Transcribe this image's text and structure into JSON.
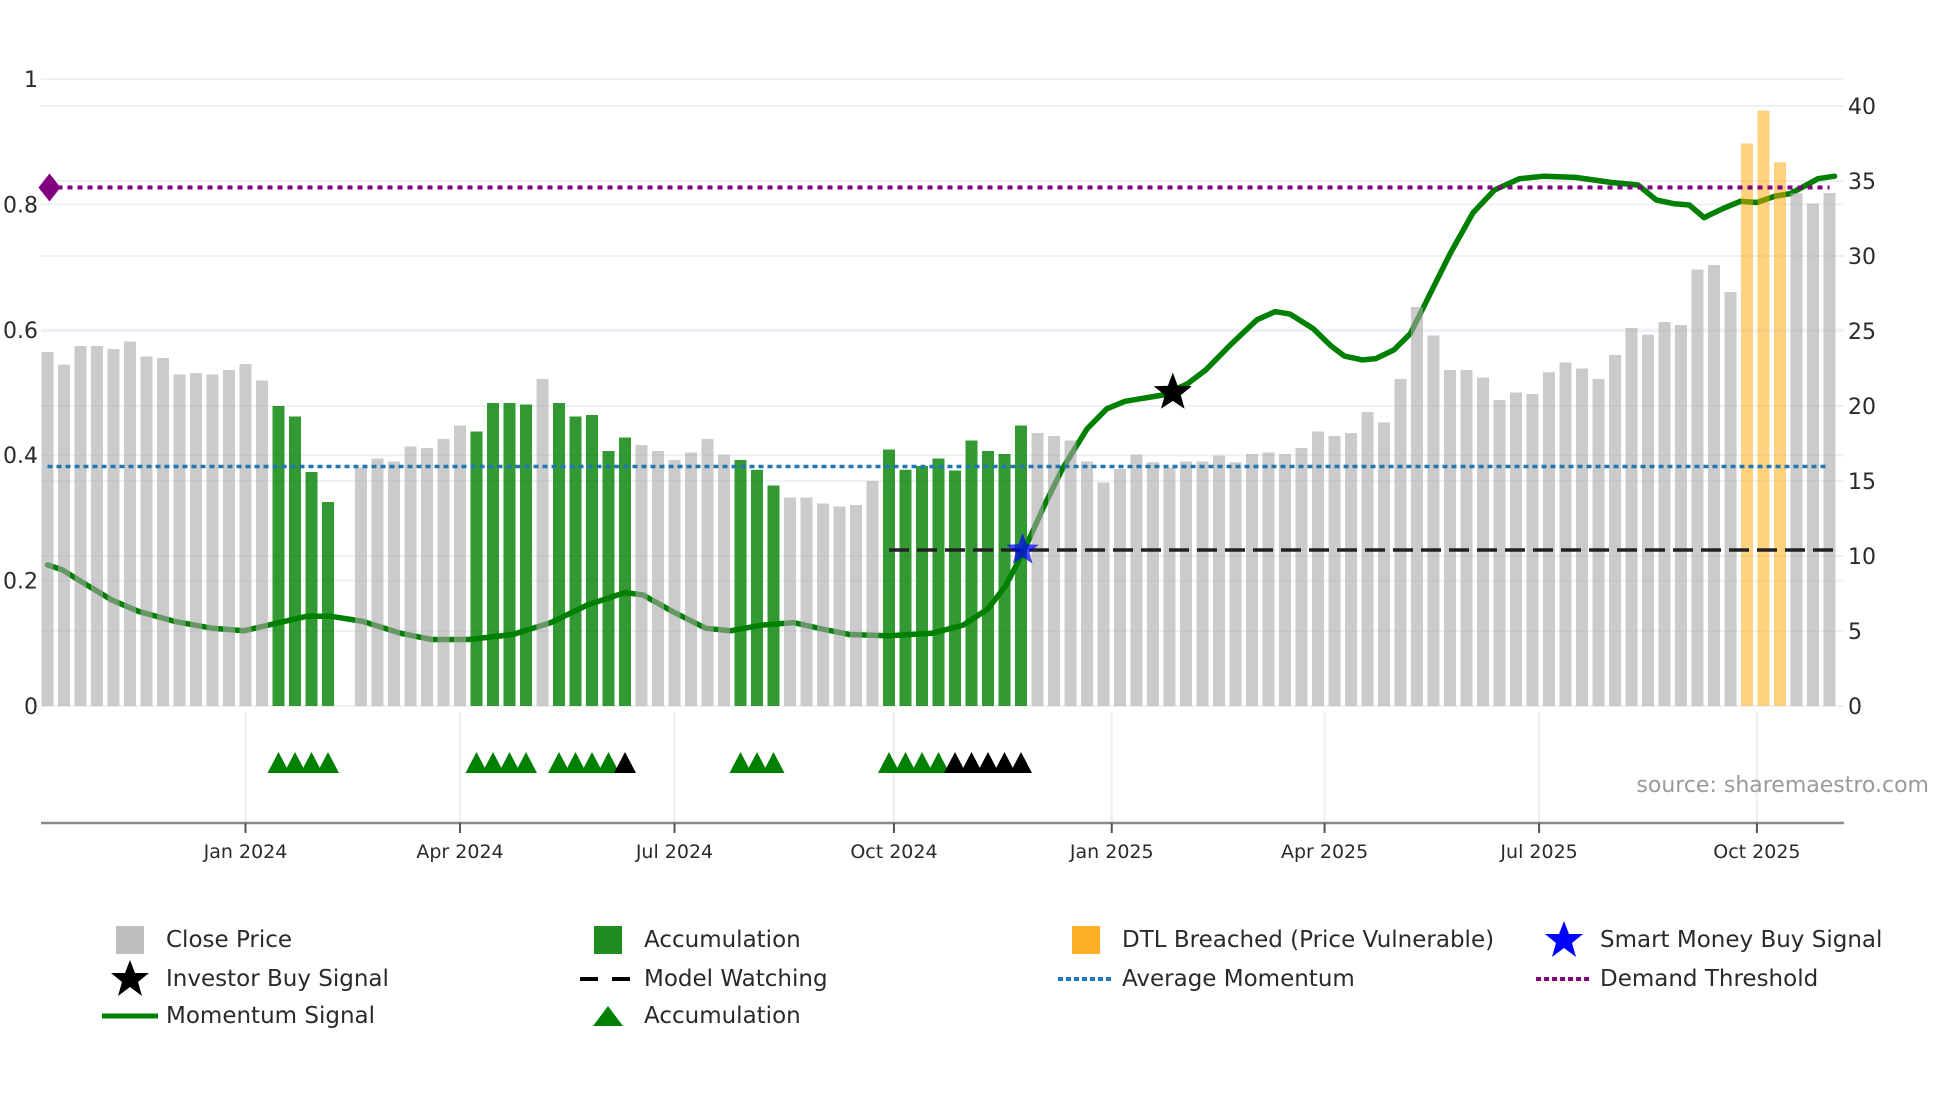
{
  "chart_data": {
    "type": "bar",
    "x_unit": "week index (weekly bars, first bar = week 0)",
    "x_ticks": [
      {
        "label": "Jan 2024",
        "x": 12.0
      },
      {
        "label": "Apr 2024",
        "x": 25.0
      },
      {
        "label": "Jul 2024",
        "x": 38.0
      },
      {
        "label": "Oct 2024",
        "x": 51.3
      },
      {
        "label": "Jan 2025",
        "x": 64.5
      },
      {
        "label": "Apr 2025",
        "x": 77.4
      },
      {
        "label": "Jul 2025",
        "x": 90.4
      },
      {
        "label": "Oct 2025",
        "x": 103.6
      }
    ],
    "y_left": {
      "range": [
        0,
        1
      ],
      "ticks": [
        "0",
        "0.2",
        "0.4",
        "0.6",
        "0.8",
        "1"
      ],
      "tick_values": [
        0,
        0.2,
        0.4,
        0.6,
        0.8,
        1
      ]
    },
    "y_right": {
      "range": [
        0,
        40
      ],
      "ticks": [
        "0",
        "5",
        "10",
        "15",
        "20",
        "25",
        "30",
        "35",
        "40"
      ],
      "tick_values": [
        0,
        5,
        10,
        15,
        20,
        25,
        30,
        35,
        40
      ]
    },
    "colors": {
      "close": "#a9a9a9",
      "accumulation": "#008000",
      "dtl": "#ffa500",
      "momentum": "#008000",
      "average": "#1f77b4",
      "demand": "#800080",
      "watching": "#000000",
      "smart_money": "#0000ff",
      "investor": "#000000"
    },
    "close_price": [
      23.6,
      22.75,
      24,
      24,
      23.8,
      24.3,
      23.3,
      23.2,
      22.1,
      22.2,
      22.1,
      22.4,
      22.8,
      21.7,
      20,
      19.3,
      15.6,
      13.6,
      null,
      15.9,
      16.5,
      16.3,
      17.3,
      17.2,
      17.8,
      18.7,
      18.3,
      20.2,
      20.2,
      20.1,
      21.8,
      20.2,
      19.3,
      19.4,
      17,
      17.9,
      17.4,
      17,
      16.4,
      16.9,
      17.8,
      16.75,
      16.4,
      15.75,
      14.7,
      13.9,
      13.9,
      13.5,
      13.3,
      13.4,
      15,
      17.1,
      15.75,
      16,
      16.5,
      15.7,
      17.7,
      17,
      16.8,
      18.7,
      18.2,
      18,
      17.7,
      16.3,
      14.9,
      15.8,
      16.75,
      16.25,
      15.9,
      16.3,
      16.3,
      16.7,
      16.25,
      16.8,
      16.9,
      16.8,
      17.2,
      18.3,
      18,
      18.2,
      19.6,
      18.9,
      21.8,
      26.6,
      24.7,
      22.4,
      22.4,
      21.9,
      20.4,
      20.9,
      20.8,
      22.25,
      22.9,
      22.5,
      21.8,
      23.4,
      25.2,
      24.75,
      25.6,
      25.4,
      29.1,
      29.4,
      27.6,
      37.5,
      39.7,
      36.25,
      34.2,
      33.5,
      34.2
    ],
    "bar_state_ranges": [
      {
        "state": "accumulation",
        "from": 14,
        "to": 17
      },
      {
        "state": "accumulation",
        "from": 26,
        "to": 29
      },
      {
        "state": "accumulation",
        "from": 31,
        "to": 35
      },
      {
        "state": "accumulation",
        "from": 42,
        "to": 44
      },
      {
        "state": "accumulation",
        "from": 51,
        "to": 59
      },
      {
        "state": "dtl",
        "from": 103,
        "to": 105
      }
    ],
    "momentum_signal": [
      [
        0,
        0.225
      ],
      [
        0.9,
        0.217
      ],
      [
        2,
        0.199
      ],
      [
        3.9,
        0.169
      ],
      [
        5.5,
        0.151
      ],
      [
        7.7,
        0.135
      ],
      [
        10,
        0.124
      ],
      [
        11.9,
        0.12
      ],
      [
        13.4,
        0.129
      ],
      [
        15.7,
        0.143
      ],
      [
        17.2,
        0.143
      ],
      [
        19.1,
        0.135
      ],
      [
        21.4,
        0.116
      ],
      [
        23.3,
        0.106
      ],
      [
        25.5,
        0.106
      ],
      [
        28.2,
        0.114
      ],
      [
        30.5,
        0.133
      ],
      [
        32.7,
        0.161
      ],
      [
        35,
        0.181
      ],
      [
        36.1,
        0.177
      ],
      [
        38,
        0.149
      ],
      [
        39.9,
        0.124
      ],
      [
        41.4,
        0.12
      ],
      [
        43.3,
        0.129
      ],
      [
        45.2,
        0.133
      ],
      [
        47.1,
        0.122
      ],
      [
        48.6,
        0.114
      ],
      [
        50.9,
        0.112
      ],
      [
        53.6,
        0.116
      ],
      [
        55.5,
        0.129
      ],
      [
        57,
        0.155
      ],
      [
        58.1,
        0.193
      ],
      [
        59.2,
        0.249
      ],
      [
        60.4,
        0.319
      ],
      [
        61.5,
        0.378
      ],
      [
        63,
        0.442
      ],
      [
        64.2,
        0.474
      ],
      [
        65.3,
        0.486
      ],
      [
        67.6,
        0.496
      ],
      [
        69.1,
        0.514
      ],
      [
        70.2,
        0.536
      ],
      [
        71.7,
        0.576
      ],
      [
        73.3,
        0.616
      ],
      [
        74.4,
        0.629
      ],
      [
        75.3,
        0.625
      ],
      [
        76.7,
        0.602
      ],
      [
        77.8,
        0.574
      ],
      [
        78.6,
        0.558
      ],
      [
        79.7,
        0.552
      ],
      [
        80.5,
        0.554
      ],
      [
        81.6,
        0.568
      ],
      [
        82.6,
        0.594
      ],
      [
        83.6,
        0.647
      ],
      [
        85,
        0.721
      ],
      [
        86.4,
        0.787
      ],
      [
        87.7,
        0.823
      ],
      [
        89.2,
        0.841
      ],
      [
        90.7,
        0.845
      ],
      [
        92.6,
        0.843
      ],
      [
        94.8,
        0.835
      ],
      [
        96.4,
        0.831
      ],
      [
        97.5,
        0.807
      ],
      [
        98.6,
        0.801
      ],
      [
        99.5,
        0.799
      ],
      [
        100.4,
        0.779
      ],
      [
        101.5,
        0.793
      ],
      [
        102.6,
        0.805
      ],
      [
        103.6,
        0.803
      ],
      [
        104.7,
        0.813
      ],
      [
        105.6,
        0.817
      ],
      [
        106.2,
        0.825
      ],
      [
        107.3,
        0.841
      ],
      [
        108.3,
        0.845
      ]
    ],
    "average_momentum": 0.382,
    "demand_threshold": 0.827,
    "model_watching": {
      "value_right": 10.4,
      "from": 51,
      "to": 108.5
    },
    "smart_money_buy_signal": {
      "x": 59.1,
      "value_right": 10.4
    },
    "investor_buy_signal": {
      "x": 68.2,
      "value_left": 0.5
    },
    "accumulation_markers_green": [
      14,
      15,
      16,
      17,
      26,
      27,
      28,
      29,
      31,
      32,
      33,
      34,
      42,
      43,
      44,
      51,
      52,
      53,
      54
    ],
    "accumulation_markers_black": [
      35,
      55,
      56,
      57,
      58,
      59
    ],
    "source": "source: sharemaestro.com",
    "legend": [
      {
        "label": "Close Price",
        "symbol": "gray-square"
      },
      {
        "label": "Accumulation",
        "symbol": "green-square"
      },
      {
        "label": "DTL Breached (Price Vulnerable)",
        "symbol": "orange-square"
      },
      {
        "label": "Smart Money Buy Signal",
        "symbol": "blue-star"
      },
      {
        "label": "Investor Buy Signal",
        "symbol": "black-star"
      },
      {
        "label": "Model Watching",
        "symbol": "black-dash"
      },
      {
        "label": "Average Momentum",
        "symbol": "blue-dot"
      },
      {
        "label": "Demand Threshold",
        "symbol": "purple-dot"
      },
      {
        "label": "Momentum Signal",
        "symbol": "green-line"
      },
      {
        "label": "Accumulation",
        "symbol": "green-triangle"
      }
    ]
  }
}
